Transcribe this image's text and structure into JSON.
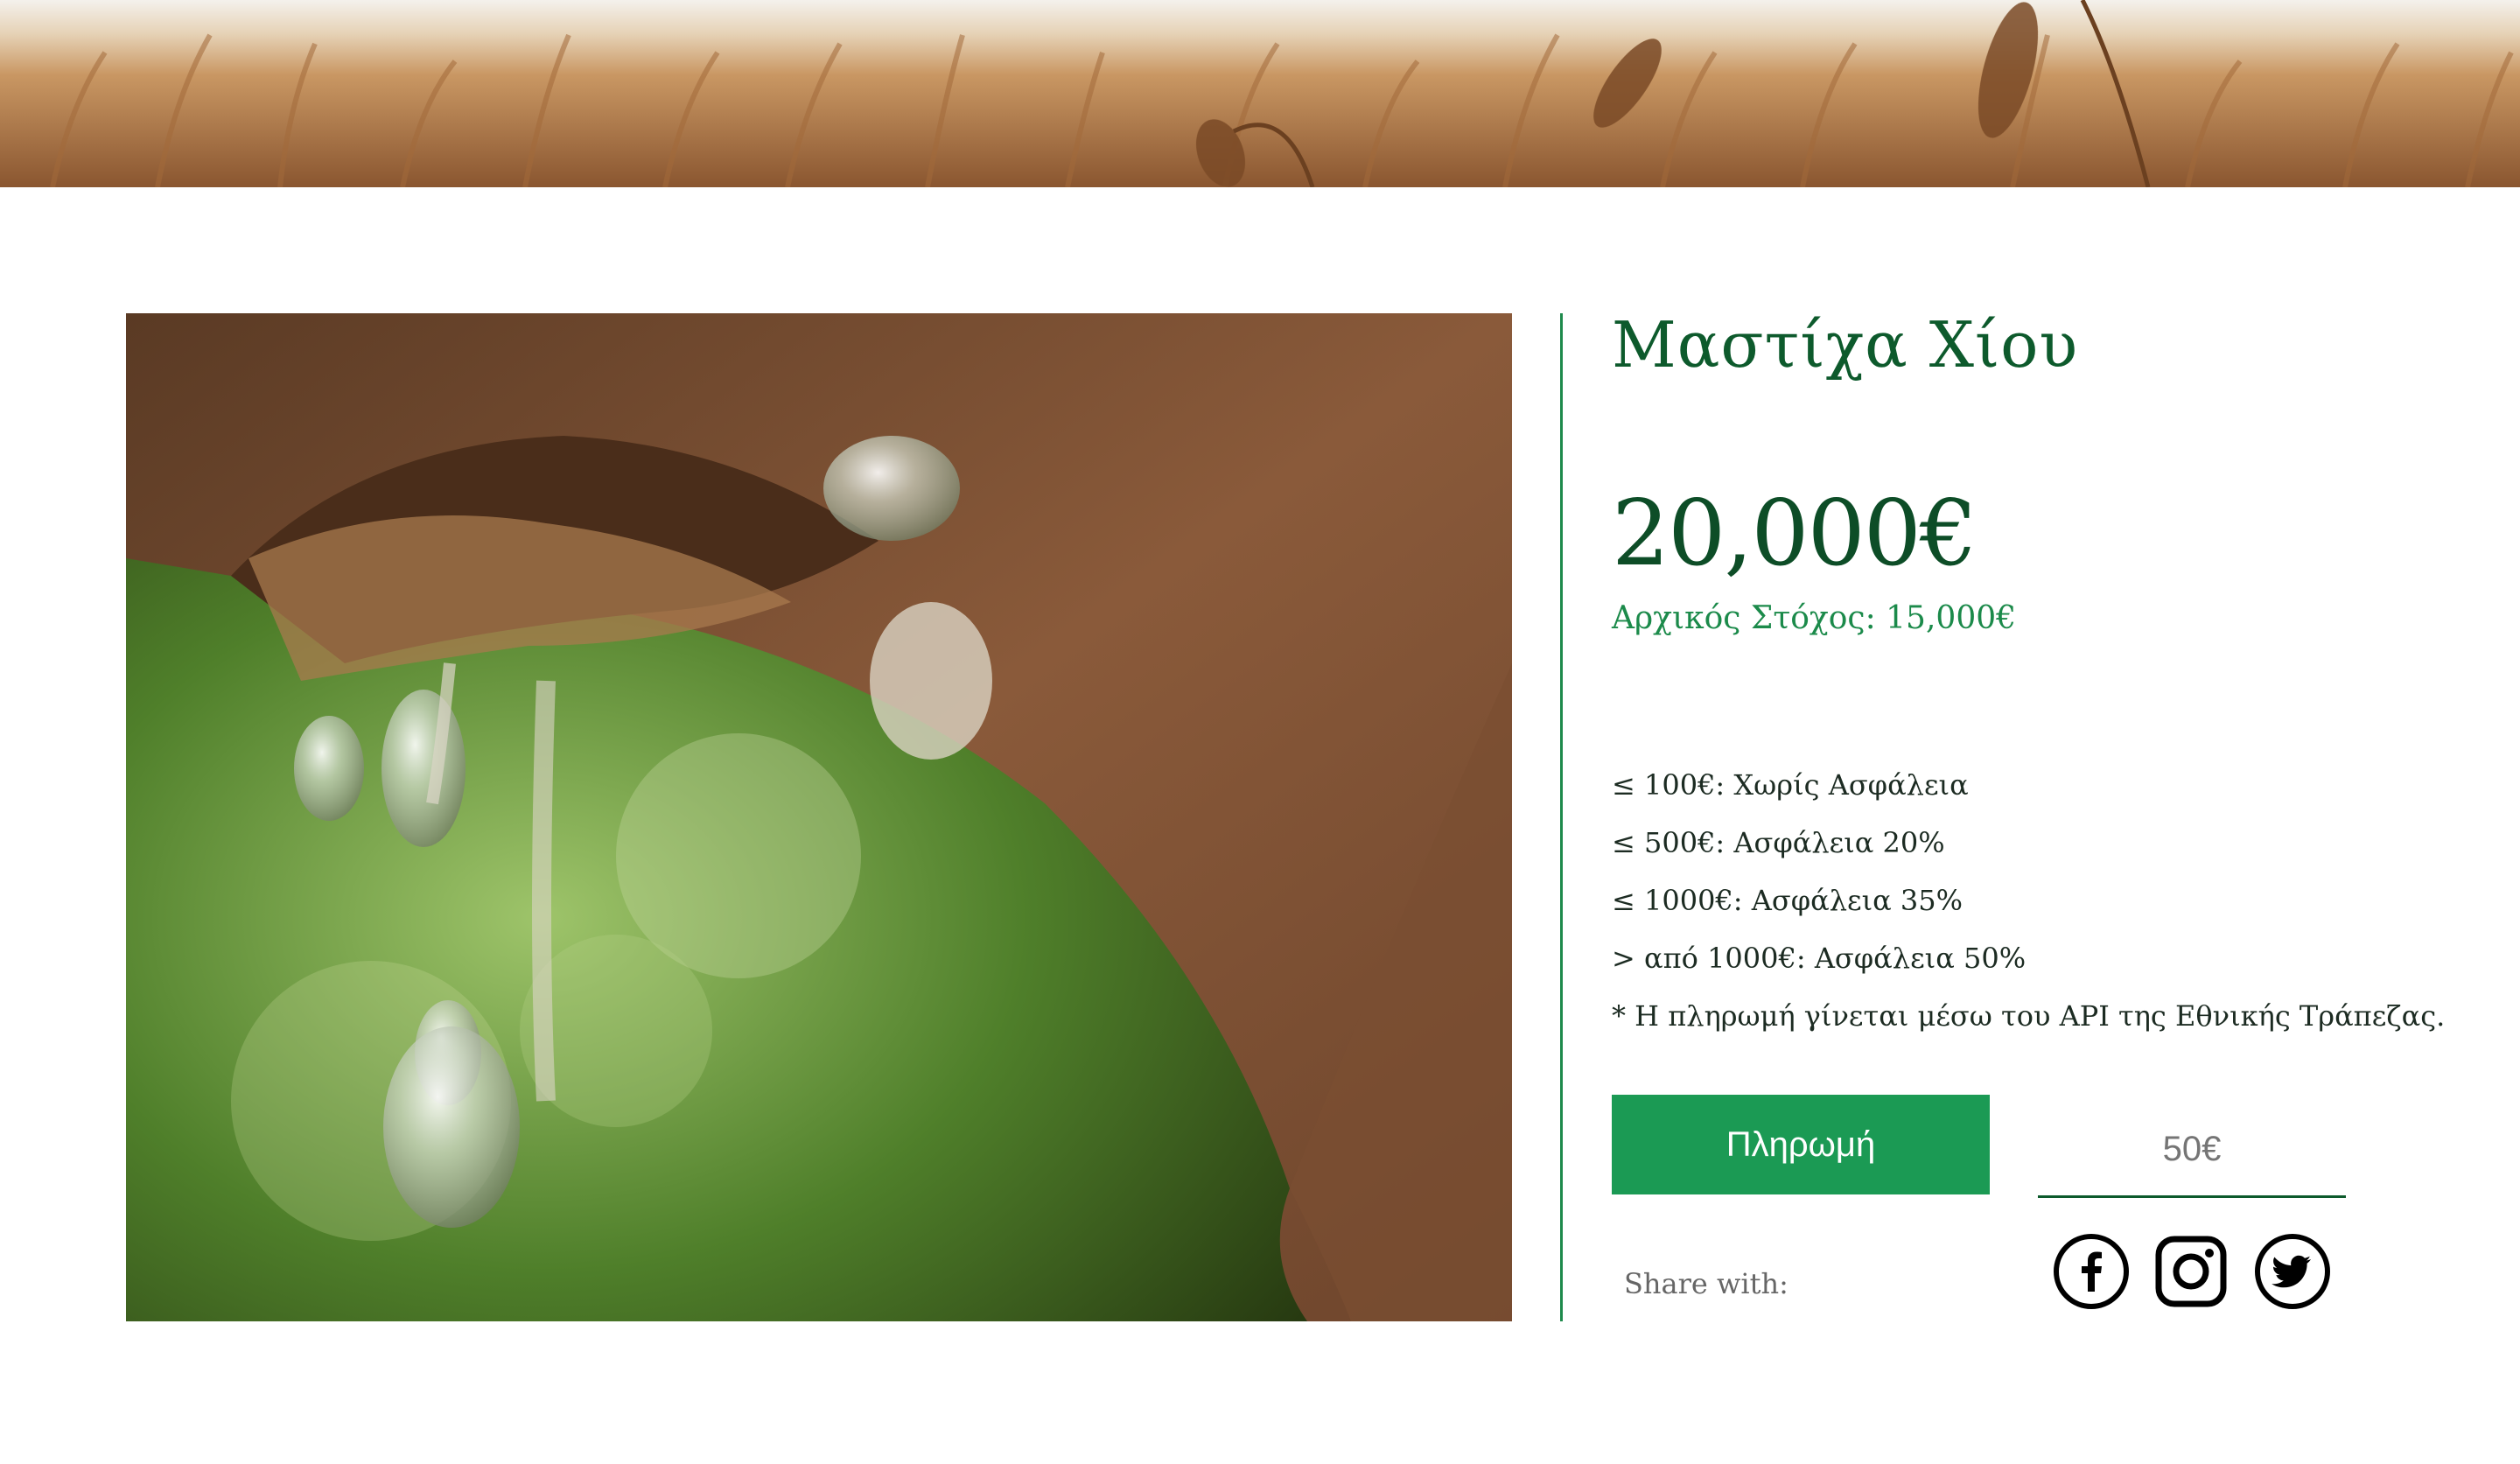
{
  "product": {
    "title": "Μαστίχα Χίου",
    "raised": "20,000€",
    "goal_label": "Αρχικός Στόχος:",
    "goal_value": "15,000€"
  },
  "tiers": [
    "≤ 100€: Χωρίς Ασφάλεια",
    "≤ 500€: Ασφάλεια 20%",
    "≤ 1000€: Ασφάλεια 35%",
    "> από 1000€: Ασφάλεια 50%",
    "* Η πληρωμή γίνεται μέσω του API της Εθνικής Τράπεζας."
  ],
  "payment": {
    "button_label": "Πληρωμή",
    "amount_placeholder": "50€"
  },
  "share": {
    "label": "Share with:",
    "networks": [
      "facebook-icon",
      "instagram-icon",
      "twitter-icon"
    ]
  },
  "colors": {
    "accent_green": "#1b9a54",
    "title_green": "#0d5a2c",
    "goal_green": "#1b8a4a"
  }
}
